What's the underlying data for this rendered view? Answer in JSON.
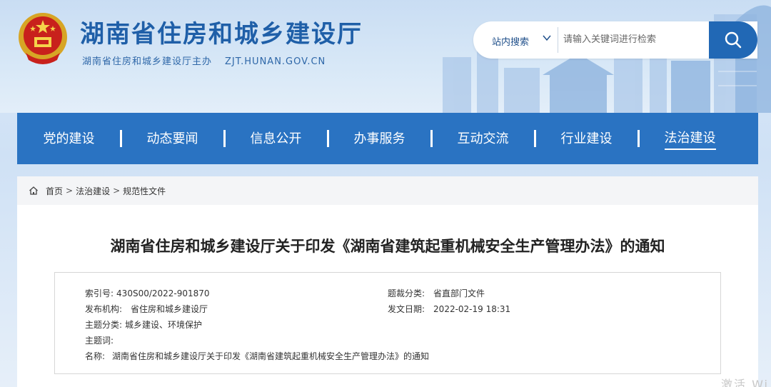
{
  "header": {
    "site_title": "湖南省住房和城乡建设厅",
    "site_sub": "湖南省住房和城乡建设厅主办",
    "domain": "ZJT.HUNAN.GOV.CN"
  },
  "search": {
    "scope": "站内搜索",
    "placeholder": "请输入关键词进行检索",
    "icon": "search-icon"
  },
  "nav": {
    "items": [
      {
        "label": "党的建设"
      },
      {
        "label": "动态要闻"
      },
      {
        "label": "信息公开"
      },
      {
        "label": "办事服务"
      },
      {
        "label": "互动交流"
      },
      {
        "label": "行业建设"
      },
      {
        "label": "法治建设"
      }
    ],
    "active_index": 6
  },
  "breadcrumb": {
    "items": [
      "首页",
      "法治建设",
      "规范性文件"
    ],
    "separator": ">"
  },
  "document": {
    "title": "湖南省住房和城乡建设厅关于印发《湖南省建筑起重机械安全生产管理办法》的通知",
    "meta": {
      "index_label": "索引号:",
      "index_value": "430S00/2022-901870",
      "category_label": "题裁分类:",
      "category_value": "省直部门文件",
      "publisher_label": "发布机构:",
      "publisher_value": "省住房和城乡建设厅",
      "date_label": "发文日期:",
      "date_value": "2022-02-19 18:31",
      "topic_label": "主题分类:",
      "topic_value": "城乡建设、环境保护",
      "keywords_label": "主题词:",
      "keywords_value": "",
      "name_label": "名称:",
      "name_value": "湖南省住房和城乡建设厅关于印发《湖南省建筑起重机械安全生产管理办法》的通知"
    }
  },
  "watermark": "激活 Wi",
  "colors": {
    "nav_bg": "#2a73c2",
    "title_blue": "#1f5fa8",
    "search_btn": "#2168b5"
  }
}
